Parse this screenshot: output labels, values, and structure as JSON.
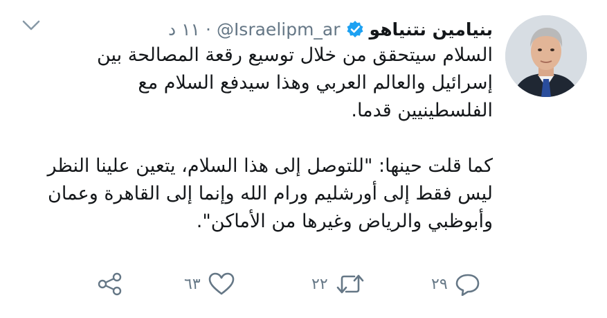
{
  "tweet": {
    "author_name": "بنيامين نتنياهو",
    "handle": "@Israelipm_ar",
    "separator": "·",
    "time": "١١ د",
    "text_lines": [
      "السلام سيتحقق من خلال توسيع رقعة المصالحة بين",
      "إسرائيل والعالم العربي وهذا  سيدفع السلام مع",
      "الفلسطينيين قدما.",
      "",
      "كما قلت حينها: \"للتوصل إلى هذا السلام، يتعين علينا النظر",
      "ليس فقط إلى أورشليم ورام الله وإنما إلى القاهرة وعمان",
      "وأبوظبي والرياض وغيرها من الأماكن\"."
    ]
  },
  "actions": {
    "reply_count": "٢٩",
    "retweet_count": "٢٢",
    "like_count": "٦٣"
  },
  "colors": {
    "text": "#14171a",
    "secondary": "#657786",
    "verified": "#1da1f2",
    "background": "#ffffff"
  },
  "icons": [
    "verified-badge-icon",
    "chevron-down-icon",
    "reply-icon",
    "retweet-icon",
    "like-icon",
    "share-icon"
  ]
}
